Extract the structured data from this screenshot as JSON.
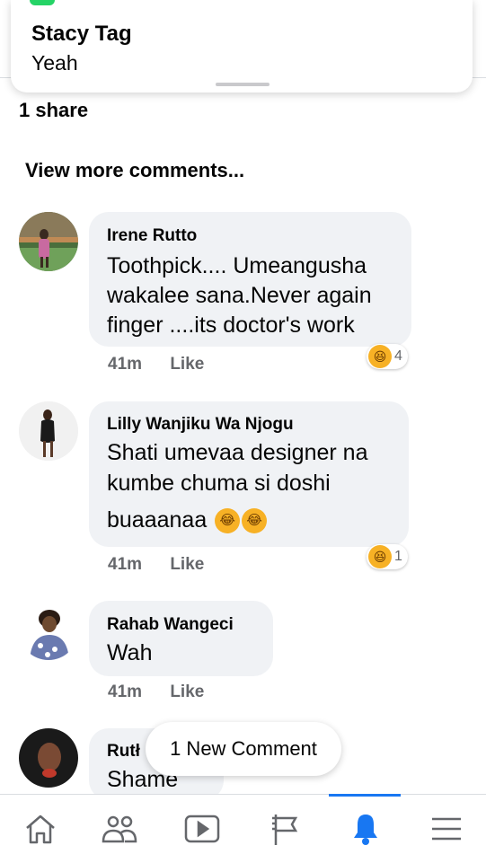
{
  "notification": {
    "title": "Stacy Tag",
    "body": "Yeah"
  },
  "post": {
    "shares": "1 share",
    "view_more": "View more comments..."
  },
  "comments": [
    {
      "author": "Irene Rutto",
      "lines": [
        "Toothpick.... Umeangusha",
        "wakalee sana.Never again",
        "finger ....its doctor's work"
      ],
      "time": "41m",
      "like": "Like",
      "reaction": "haha-icon",
      "reaction_count": "4"
    },
    {
      "author": "Lilly Wanjiku Wa Njogu",
      "lines": [
        "Shati umevaa designer na",
        "kumbe chuma si doshi",
        "buaaanaa"
      ],
      "inline_emojis": [
        "joy-emoji",
        "joy-emoji"
      ],
      "time": "41m",
      "like": "Like",
      "reaction": "haha-icon",
      "reaction_count": "1"
    },
    {
      "author": "Rahab Wangeci",
      "lines": [
        "Wah"
      ],
      "time": "41m",
      "like": "Like"
    },
    {
      "author": "Rutł",
      "lines": [
        "Shame"
      ]
    }
  ],
  "new_comment_pill": "1 New Comment",
  "tabbar": {
    "items": [
      "home-icon",
      "friends-icon",
      "watch-icon",
      "pages-icon",
      "notifications-icon",
      "menu-icon"
    ],
    "active": "notifications-icon",
    "accent": "#1877f2"
  }
}
